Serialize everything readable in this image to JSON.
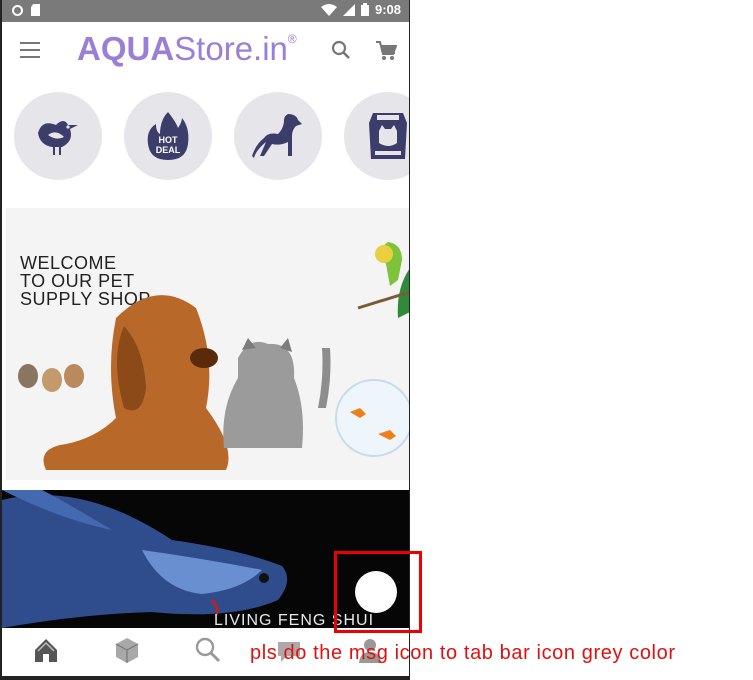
{
  "status_bar": {
    "time": "9:08"
  },
  "app_bar": {
    "brand_bold": "AQUA",
    "brand_rest": "Store.in",
    "brand_mark": "®",
    "brand_color": "#9b7fd6"
  },
  "categories": [
    {
      "icon": "bird-icon"
    },
    {
      "icon": "hot-deal-icon",
      "label": "HOT DEAL"
    },
    {
      "icon": "dog-icon"
    },
    {
      "icon": "cat-food-icon"
    }
  ],
  "banner_welcome": {
    "line1": "WELCOME",
    "line2": "TO OUR PET",
    "line3": "SUPPLY SHOP"
  },
  "banner_fish": {
    "caption": "LIVING FENG SHUI"
  },
  "tab_bar": {
    "tabs": [
      {
        "icon": "home-icon"
      },
      {
        "icon": "box-icon"
      },
      {
        "icon": "search-icon"
      },
      {
        "icon": "message-icon"
      },
      {
        "icon": "user-icon"
      }
    ]
  },
  "annotation": {
    "text": "pls do the msg icon to tab bar icon grey color",
    "color": "#e01010"
  }
}
